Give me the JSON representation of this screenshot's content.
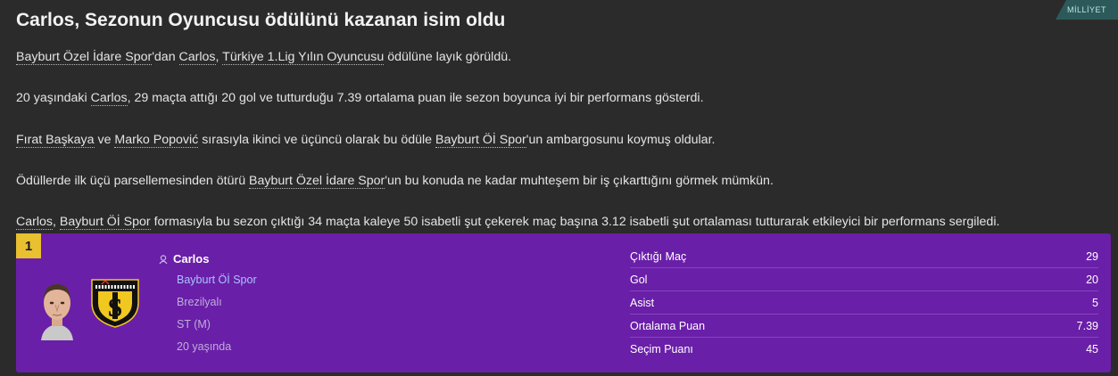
{
  "source_badge": "MİLLİYET",
  "headline": "Carlos, Sezonun Oyuncusu ödülünü kazanan isim oldu",
  "paragraphs": {
    "p1": {
      "team": "Bayburt Özel İdare Spor",
      "t1": "'dan ",
      "player": "Carlos",
      "t2": ", ",
      "award": "Türkiye 1.Lig Yılın Oyuncusu",
      "t3": " ödülüne layık görüldü."
    },
    "p2": {
      "t1": "20 yaşındaki ",
      "player": "Carlos",
      "t2": ", 29 maçta attığı 20 gol ve tutturduğu 7.39 ortalama puan ile sezon boyunca iyi bir performans gösterdi."
    },
    "p3": {
      "second": "Fırat Başkaya",
      "t1": " ve ",
      "third": "Marko Popović",
      "t2": " sırasıyla ikinci ve üçüncü olarak bu ödüle ",
      "team": "Bayburt Öİ Spor",
      "t3": "'un ambargosunu koymuş oldular."
    },
    "p4": {
      "t1": "Ödüllerde ilk üçü parsellemesinden ötürü ",
      "team": "Bayburt Özel İdare Spor",
      "t2": "'un bu konuda ne kadar muhteşem bir iş çıkarttığını görmek mümkün."
    },
    "p5": {
      "player": "Carlos",
      "t1": ", ",
      "team": "Bayburt Öİ Spor",
      "t2": " formasıyla bu sezon çıktığı 34 maçta kaleye 50 isabetli şut çekerek maç başına 3.12 isabetli şut ortalaması tutturarak etkileyici bir performans sergiledi."
    }
  },
  "card": {
    "rank": "1",
    "player_name": "Carlos",
    "club": "Bayburt Öİ Spor",
    "nationality": "Brezilyalı",
    "position": "ST (M)",
    "age": "20 yaşında",
    "stats": [
      {
        "label": "Çıktığı Maç",
        "value": "29"
      },
      {
        "label": "Gol",
        "value": "20"
      },
      {
        "label": "Asist",
        "value": "5"
      },
      {
        "label": "Ortalama Puan",
        "value": "7.39"
      },
      {
        "label": "Seçim Puanı",
        "value": "45"
      }
    ]
  },
  "colors": {
    "background": "#2b2b2b",
    "card": "#6a1fa8",
    "rank_badge": "#e8c030",
    "source_badge": "#2c5a5a"
  }
}
